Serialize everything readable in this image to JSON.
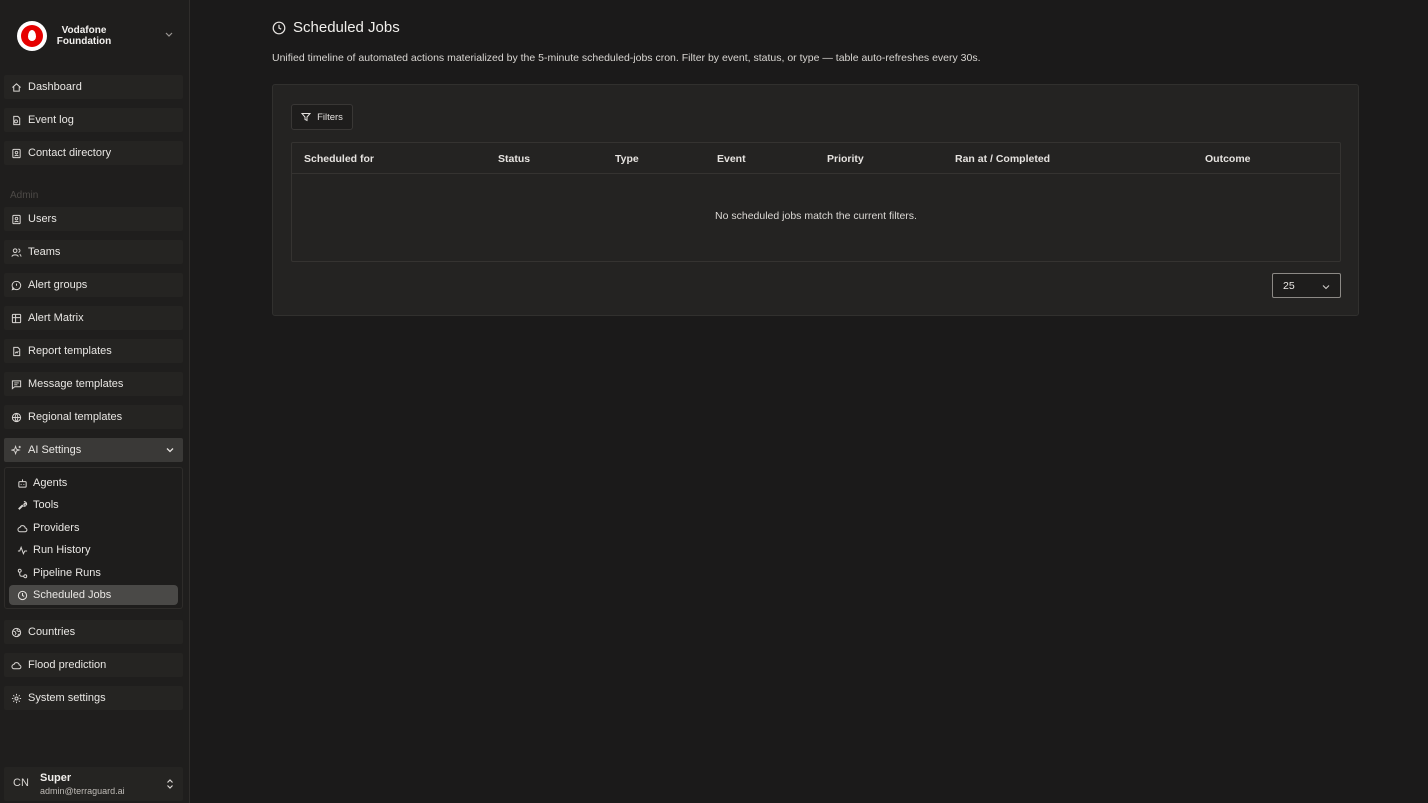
{
  "brand": {
    "name_line1": "Vodafone",
    "name_line2": "Foundation"
  },
  "sidebar": {
    "items_top": [
      {
        "label": "Dashboard",
        "icon": "home-icon"
      },
      {
        "label": "Event log",
        "icon": "event-log-icon"
      },
      {
        "label": "Contact directory",
        "icon": "contact-icon"
      }
    ],
    "section_label": "Admin",
    "items_admin": [
      {
        "label": "Users",
        "icon": "user-icon"
      },
      {
        "label": "Teams",
        "icon": "users-icon"
      },
      {
        "label": "Alert groups",
        "icon": "alert-bubble-icon"
      },
      {
        "label": "Alert Matrix",
        "icon": "grid-icon"
      },
      {
        "label": "Report templates",
        "icon": "report-icon"
      },
      {
        "label": "Message templates",
        "icon": "message-icon"
      },
      {
        "label": "Regional templates",
        "icon": "globe-icon"
      },
      {
        "label": "AI Settings",
        "icon": "sparkles-icon",
        "expanded": true
      }
    ],
    "ai_submenu": [
      {
        "label": "Agents",
        "icon": "robot-icon"
      },
      {
        "label": "Tools",
        "icon": "wrench-icon"
      },
      {
        "label": "Providers",
        "icon": "cloud-icon"
      },
      {
        "label": "Run History",
        "icon": "activity-icon"
      },
      {
        "label": "Pipeline Runs",
        "icon": "pipeline-icon"
      },
      {
        "label": "Scheduled Jobs",
        "icon": "clock-icon",
        "active": true
      }
    ],
    "items_bottom": [
      {
        "label": "Countries",
        "icon": "earth-icon"
      },
      {
        "label": "Flood prediction",
        "icon": "cloud-icon"
      },
      {
        "label": "System settings",
        "icon": "gear-icon"
      }
    ]
  },
  "user": {
    "initials": "CN",
    "name": "Super",
    "email": "admin@terraguard.ai"
  },
  "page": {
    "title": "Scheduled Jobs",
    "description": "Unified timeline of automated actions materialized by the 5-minute scheduled-jobs cron. Filter by event, status, or type — table auto-refreshes every 30s."
  },
  "filters_label": "Filters",
  "table": {
    "columns": [
      "Scheduled for",
      "Status",
      "Type",
      "Event",
      "Priority",
      "Ran at / Completed",
      "Outcome"
    ],
    "empty_message": "No scheduled jobs match the current filters."
  },
  "page_size": {
    "value": "25"
  },
  "colors": {
    "background": "#1b1a1a",
    "sidebar": "#1f1e1d",
    "card": "#242322",
    "brand_red": "#e60000"
  }
}
